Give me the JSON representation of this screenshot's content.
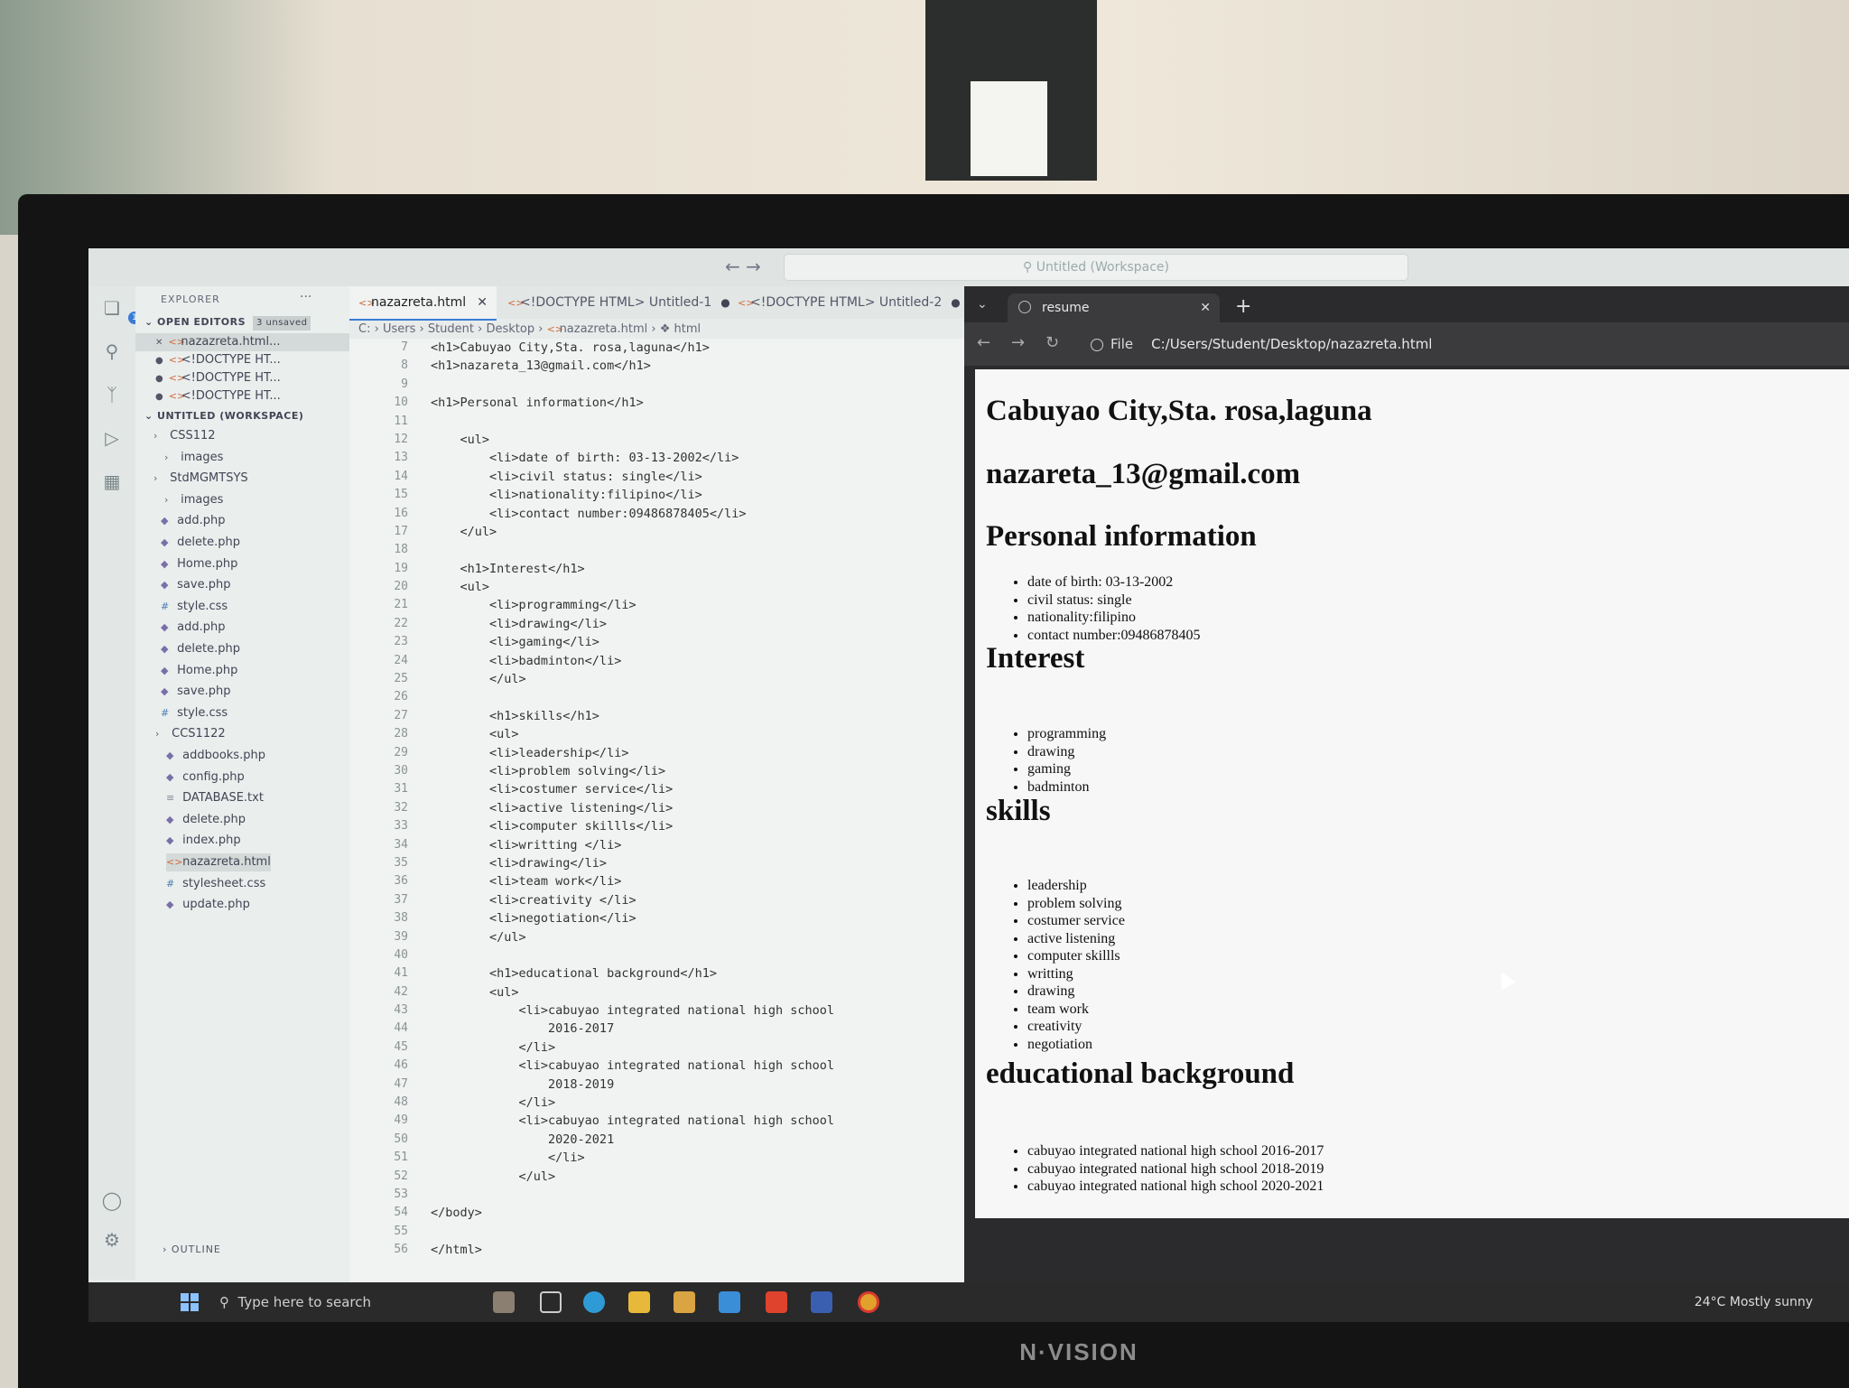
{
  "window": {
    "title": "Untitled (Workspace)"
  },
  "explorer": {
    "title": "EXPLORER",
    "more": "···",
    "open_editors": {
      "label": "OPEN EDITORS",
      "badge": "3 unsaved",
      "items": [
        "nazazreta.html...",
        "<!DOCTYPE HT...",
        "<!DOCTYPE HT...",
        "<!DOCTYPE HT..."
      ]
    },
    "workspace": "UNTITLED (WORKSPACE)",
    "tree": [
      {
        "label": "CSS112",
        "type": "folder"
      },
      {
        "label": "images",
        "type": "folder"
      },
      {
        "label": "StdMGMTSYS",
        "type": "folder"
      },
      {
        "label": "images",
        "type": "folder"
      },
      {
        "label": "add.php",
        "type": "php"
      },
      {
        "label": "delete.php",
        "type": "php"
      },
      {
        "label": "Home.php",
        "type": "php"
      },
      {
        "label": "save.php",
        "type": "php"
      },
      {
        "label": "style.css",
        "type": "css"
      },
      {
        "label": "add.php",
        "type": "php"
      },
      {
        "label": "delete.php",
        "type": "php"
      },
      {
        "label": "Home.php",
        "type": "php"
      },
      {
        "label": "save.php",
        "type": "php"
      },
      {
        "label": "style.css",
        "type": "css"
      },
      {
        "label": "CCS1122",
        "type": "folder"
      },
      {
        "label": "addbooks.php",
        "type": "php"
      },
      {
        "label": "config.php",
        "type": "php"
      },
      {
        "label": "DATABASE.txt",
        "type": "txt"
      },
      {
        "label": "delete.php",
        "type": "php"
      },
      {
        "label": "index.php",
        "type": "php"
      },
      {
        "label": "nazazreta.html",
        "type": "html"
      },
      {
        "label": "stylesheet.css",
        "type": "css"
      },
      {
        "label": "update.php",
        "type": "php"
      }
    ],
    "outline": "OUTLINE"
  },
  "tabs": [
    {
      "label": "nazazreta.html"
    },
    {
      "label": "<!DOCTYPE HTML>",
      "sub": "Untitled-1"
    },
    {
      "label": "<!DOCTYPE HTML>",
      "sub": "Untitled-2"
    }
  ],
  "breadcrumb": [
    "C:",
    "Users",
    "Student",
    "Desktop",
    "nazazreta.html",
    "html"
  ],
  "editor": {
    "line_numbers": [
      "7",
      "8",
      "9",
      "10",
      "11",
      "12",
      "13",
      "14",
      "15",
      "16",
      "17",
      "18",
      "19",
      "20",
      "21",
      "22",
      "23",
      "24",
      "25",
      "26",
      "27",
      "28",
      "29",
      "30",
      "31",
      "32",
      "33",
      "34",
      "35",
      "36",
      "37",
      "38",
      "39",
      "40",
      "41",
      "42",
      "43",
      "44",
      "45",
      "46",
      "47",
      "48",
      "49",
      "50",
      "51",
      "52",
      "53",
      "54",
      "55",
      "56"
    ],
    "lines": [
      "<h1>Cabuyao City,Sta. rosa,laguna</h1>",
      "<h1>nazareta_13@gmail.com</h1>",
      "",
      "<h1>Personal information</h1>",
      "",
      "    <ul>",
      "        <li>date of birth: 03-13-2002</li>",
      "        <li>civil status: single</li>",
      "        <li>nationality:filipino</li>",
      "        <li>contact number:09486878405</li>",
      "    </ul>",
      "",
      "    <h1>Interest</h1>",
      "    <ul>",
      "        <li>programming</li>",
      "        <li>drawing</li>",
      "        <li>gaming</li>",
      "        <li>badminton</li>",
      "        </ul>",
      "",
      "        <h1>skills</h1>",
      "        <ul>",
      "        <li>leadership</li>",
      "        <li>problem solving</li>",
      "        <li>costumer service</li>",
      "        <li>active listening</li>",
      "        <li>computer skillls</li>",
      "        <li>writting </li>",
      "        <li>drawing</li>",
      "        <li>team work</li>",
      "        <li>creativity </li>",
      "        <li>negotiation</li>",
      "        </ul>",
      "",
      "        <h1>educational background</h1>",
      "        <ul>",
      "            <li>cabuyao integrated national high school",
      "                2016-2017",
      "            </li>",
      "            <li>cabuyao integrated national high school",
      "                2018-2019",
      "            </li>",
      "            <li>cabuyao integrated national high school",
      "                2020-2021",
      "                </li>",
      "            </ul>",
      "",
      "</body>",
      "",
      "</html>"
    ]
  },
  "browser": {
    "tab_title": "resume",
    "new_tab": "+",
    "url_scheme": "File",
    "url": "C:/Users/Student/Desktop/nazazreta.html",
    "page": {
      "address": "Cabuyao City,Sta. rosa,laguna",
      "email": "nazareta_13@gmail.com",
      "personal_heading": "Personal information",
      "personal": [
        "date of birth: 03-13-2002",
        "civil status: single",
        "nationality:filipino",
        "contact number:09486878405"
      ],
      "interest_heading": "Interest",
      "interests": [
        "programming",
        "drawing",
        "gaming",
        "badminton"
      ],
      "skills_heading": "skills",
      "skills": [
        "leadership",
        "problem solving",
        "costumer service",
        "active listening",
        "computer skillls",
        "writting",
        "drawing",
        "team work",
        "creativity",
        "negotiation"
      ],
      "education_heading": "educational background",
      "education": [
        "cabuyao integrated national high school 2016-2017",
        "cabuyao integrated national high school 2018-2019",
        "cabuyao integrated national high school 2020-2021"
      ]
    }
  },
  "taskbar": {
    "search_placeholder": "Type here to search",
    "weather": "24°C  Mostly sunny"
  },
  "monitor_brand": "N·VISION"
}
